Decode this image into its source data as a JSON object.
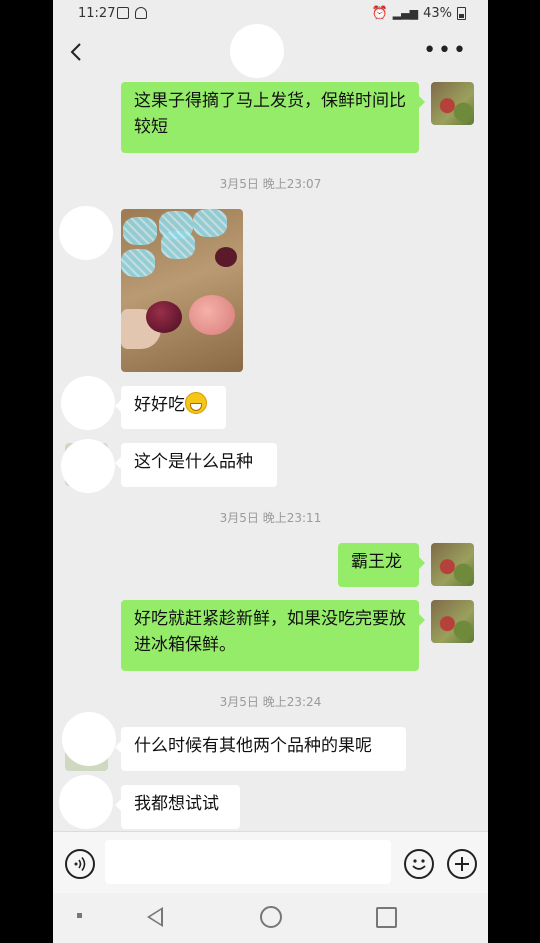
{
  "status": {
    "time": "11:27",
    "battery": "43%"
  },
  "header": {
    "back_icon": "chevron-left-icon",
    "more_icon": "more-dots-icon"
  },
  "messages": [
    {
      "side": "me",
      "text": "这果子得摘了马上发货，保鲜时间比较短"
    },
    {
      "timestamp": "3月5日 晚上23:07"
    },
    {
      "side": "other",
      "type": "image"
    },
    {
      "side": "other",
      "text": "好好吃"
    },
    {
      "side": "other",
      "text": "这个是什么品种"
    },
    {
      "timestamp": "3月5日 晚上23:11"
    },
    {
      "side": "me",
      "text": "霸王龙"
    },
    {
      "side": "me",
      "text": "好吃就赶紧趁新鲜，如果没吃完要放进冰箱保鲜。"
    },
    {
      "timestamp": "3月5日 晚上23:24"
    },
    {
      "side": "other",
      "text": "什么时候有其他两个品种的果呢"
    },
    {
      "side": "other",
      "text": "我都想试试"
    }
  ],
  "input": {
    "value": "",
    "placeholder": ""
  },
  "colors": {
    "my_bubble": "#95ec69",
    "other_bubble": "#ffffff",
    "background": "#ededed"
  }
}
